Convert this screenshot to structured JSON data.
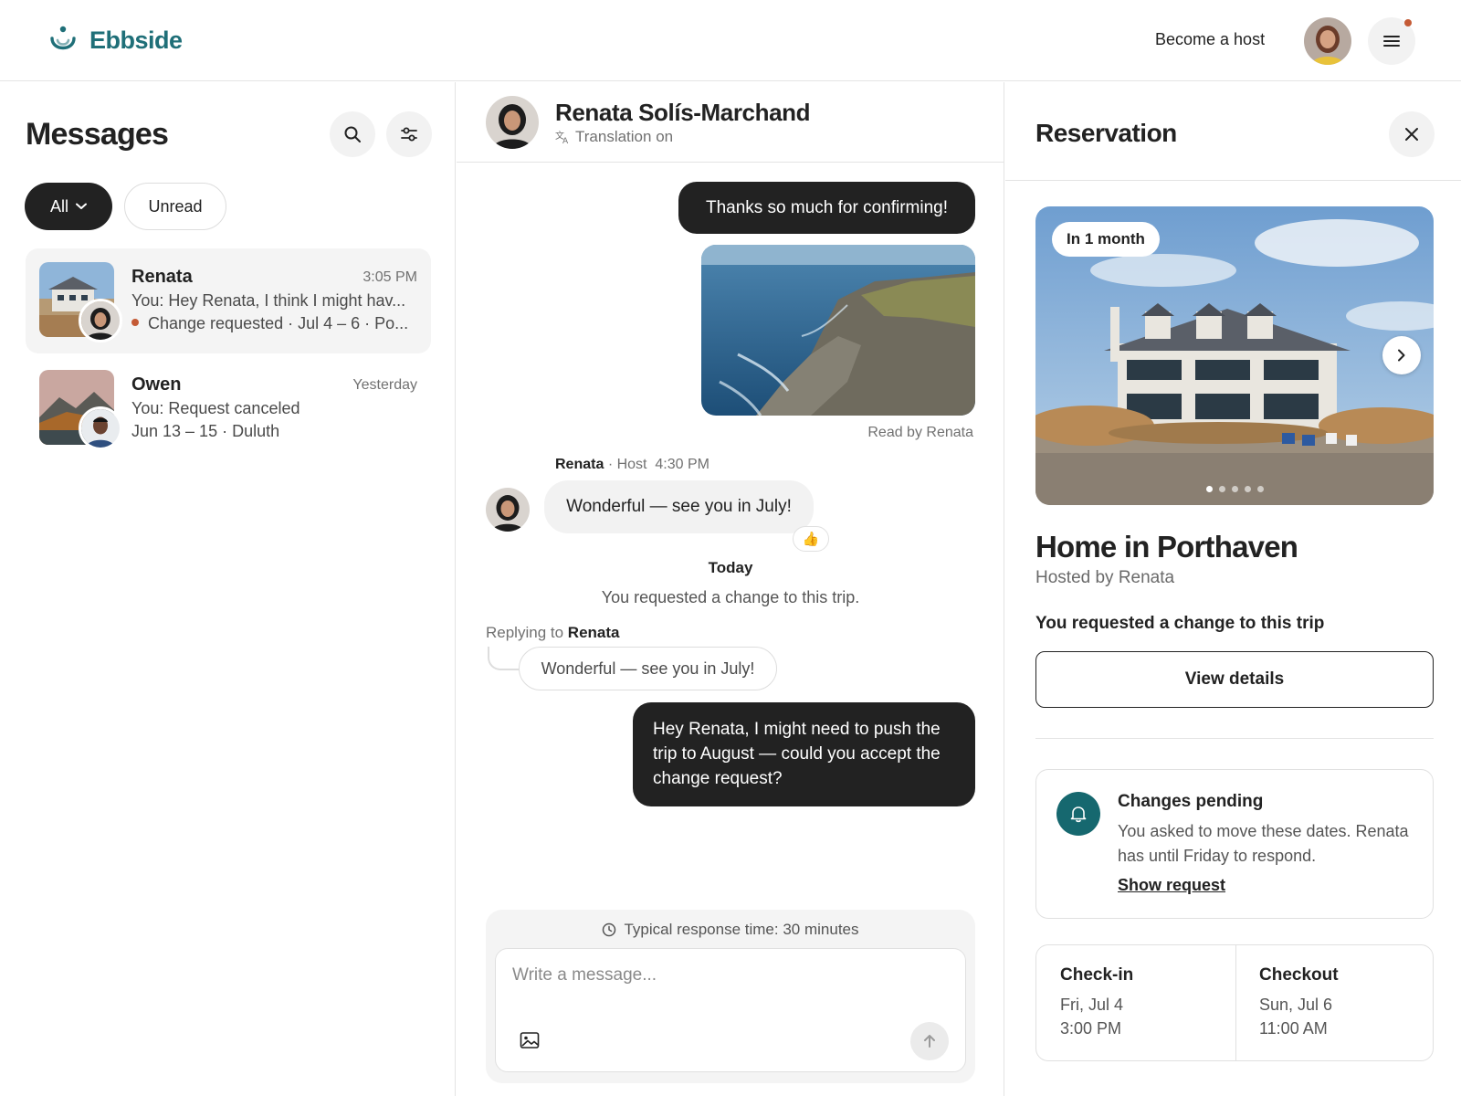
{
  "app": {
    "brand": "Ebbside",
    "become_host": "Become a host",
    "brand_color": "#1f6f78",
    "accent_dot_color": "#c45a35"
  },
  "inbox": {
    "title": "Messages",
    "filters": {
      "all": "All",
      "unread": "Unread"
    },
    "conversations": [
      {
        "name": "Renata",
        "time": "3:05 PM",
        "preview": "You: Hey Renata, I think I might hav...",
        "status": "Change requested · Jul 4 – 6 · Po...",
        "has_status_dot": true,
        "active": true
      },
      {
        "name": "Owen",
        "time": "Yesterday",
        "preview": "You: Request canceled",
        "status": "Jun 13 – 15 · Duluth",
        "has_status_dot": false,
        "active": false
      }
    ]
  },
  "chat": {
    "contact_name": "Renata Solís-Marchand",
    "translation": "Translation on",
    "messages": {
      "thanks": "Thanks so much for confirming!",
      "read_by": "Read by Renata",
      "sender_name": "Renata",
      "sender_role": "· Host",
      "sender_time": "4:30 PM",
      "wonderful": "Wonderful — see you in July!",
      "reaction": "👍",
      "today": "Today",
      "system": "You requested a change to this trip.",
      "replying_to_prefix": "Replying to",
      "replying_to_name": "Renata",
      "quoted": "Wonderful — see you in July!",
      "push": "Hey Renata, I might need to push the trip to August — could you accept the change request?"
    },
    "composer": {
      "response_time": "Typical response time: 30 minutes",
      "placeholder": "Write a message..."
    }
  },
  "reservation": {
    "title": "Reservation",
    "badge": "In 1 month",
    "photo_count": 5,
    "photo_active_index": 0,
    "listing_title": "Home in Porthaven",
    "hosted_by": "Hosted by Renata",
    "change_note": "You requested a change to this trip",
    "view_details": "View details",
    "pending": {
      "title": "Changes pending",
      "text": "You asked to move these dates. Renata has until Friday to respond.",
      "link": "Show request",
      "icon_color": "#16686f"
    },
    "checkin": {
      "label": "Check-in",
      "date": "Fri, Jul 4",
      "time": "3:00 PM"
    },
    "checkout": {
      "label": "Checkout",
      "date": "Sun, Jul 6",
      "time": "11:00 AM"
    }
  }
}
